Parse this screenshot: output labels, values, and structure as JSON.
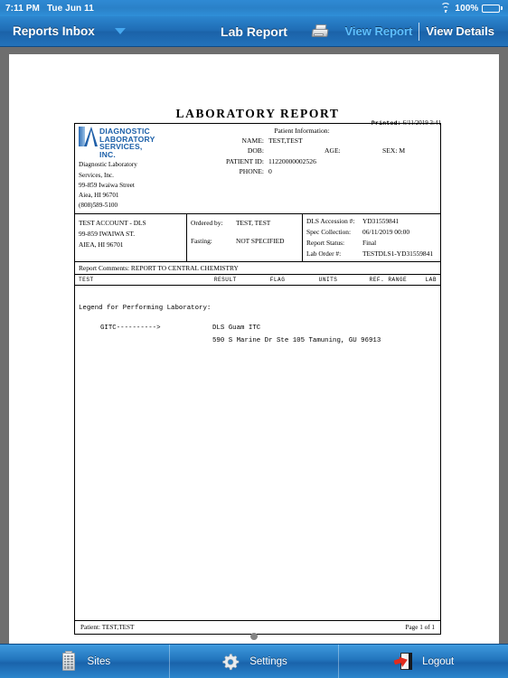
{
  "status_bar": {
    "time": "7:11 PM",
    "date": "Tue Jun 11",
    "battery_percent": "100%",
    "wifi_icon": "wifi-icon",
    "battery_icon": "battery-full-icon"
  },
  "navbar": {
    "back_label": "Reports Inbox",
    "dropdown_icon": "chevron-down-icon",
    "title": "Lab Report",
    "print_icon": "printer-icon",
    "segment": [
      {
        "label": "View Report",
        "state": "selected"
      },
      {
        "label": "View Details",
        "state": "normal"
      }
    ]
  },
  "document": {
    "title": "LABORATORY REPORT",
    "printed_label": "Printed:",
    "printed_value": "6/11/2019 3:41",
    "logo": {
      "line1": "DIAGNOSTIC",
      "line2": "LABORATORY",
      "line3": "SERVICES, INC."
    },
    "lab_address": [
      "Diagnostic Laboratory Services, Inc.",
      "99-859 Iwaiwa Street",
      "Aiea, HI 96701",
      "(808)589-5100"
    ],
    "patient_info": {
      "heading": "Patient Information:",
      "name_label": "NAME:",
      "name_value": "TEST,TEST",
      "dob_label": "DOB:",
      "dob_value": "",
      "age_label": "AGE:",
      "age_value": "",
      "sex_label": "SEX:",
      "sex_value": "M",
      "patient_id_label": "PATIENT ID:",
      "patient_id_value": "11220000002526",
      "phone_label": "PHONE:",
      "phone_value": "0"
    },
    "account": [
      "TEST ACCOUNT - DLS",
      "99-859 IWAIWA ST.",
      "AIEA, HI 96701"
    ],
    "order": {
      "ordered_by_label": "Ordered by:",
      "ordered_by_value": "TEST, TEST",
      "fasting_label": "Fasting:",
      "fasting_value": "NOT SPECIFIED"
    },
    "accession": [
      {
        "label": "DLS Accession #:",
        "value": "YD31559841"
      },
      {
        "label": "Spec Collection:",
        "value": "06/11/2019 00:00"
      },
      {
        "label": "Report Status:",
        "value": "Final"
      },
      {
        "label": "Lab Order #:",
        "value": "TESTDLS1-YD31559841"
      }
    ],
    "comments_label": "Report Comments:",
    "comments_value": "REPORT TO CENTRAL CHEMISTRY",
    "columns": [
      "TEST",
      "RESULT",
      "FLAG",
      "UNITS",
      "REF. RANGE",
      "LAB"
    ],
    "body": {
      "legend_title": "Legend for Performing Laboratory:",
      "legend_key": "GITC---------->",
      "legend_value_line1": "DLS Guam ITC",
      "legend_value_line2": "590 S Marine Dr Ste 105 Tamuning, GU 96913"
    },
    "footer": {
      "patient_label": "Patient:",
      "patient_value": "TEST,TEST",
      "page_label": "Page 1 of 1"
    }
  },
  "page_indicator": {
    "count": 1,
    "active": 0
  },
  "tabbar": [
    {
      "label": "Sites",
      "icon": "building-icon"
    },
    {
      "label": "Settings",
      "icon": "gear-icon"
    },
    {
      "label": "Logout",
      "icon": "logout-door-icon"
    }
  ],
  "colors": {
    "nav_blue": "#1f6cb4",
    "link_blue": "#5fc0ff",
    "paper_gray": "#6e6e6e",
    "logo_blue": "#1b5fa8",
    "logout_red": "#e02b1d"
  }
}
